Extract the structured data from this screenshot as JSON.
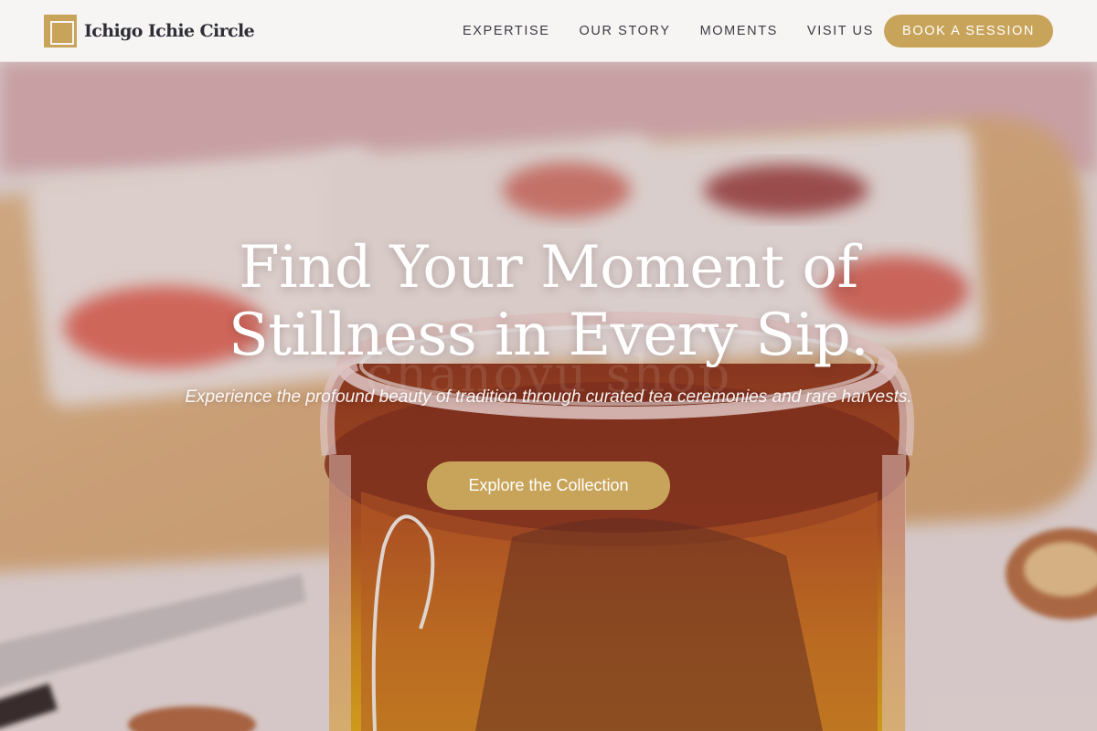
{
  "brand": {
    "name": "Ichigo Ichie Circle",
    "accent_color": "#c8a45a"
  },
  "nav": {
    "links": [
      "EXPERTISE",
      "OUR STORY",
      "MOMENTS",
      "VISIT US"
    ],
    "cta_label": "BOOK A SESSION"
  },
  "hero": {
    "title_line1": "Find Your Moment of",
    "title_line2": "Stillness in Every Sip.",
    "watermark": "chanoyu shop",
    "subtitle": "Experience the profound beauty of tradition through curated tea ceremonies and rare harvests.",
    "button_label": "Explore the Collection"
  }
}
